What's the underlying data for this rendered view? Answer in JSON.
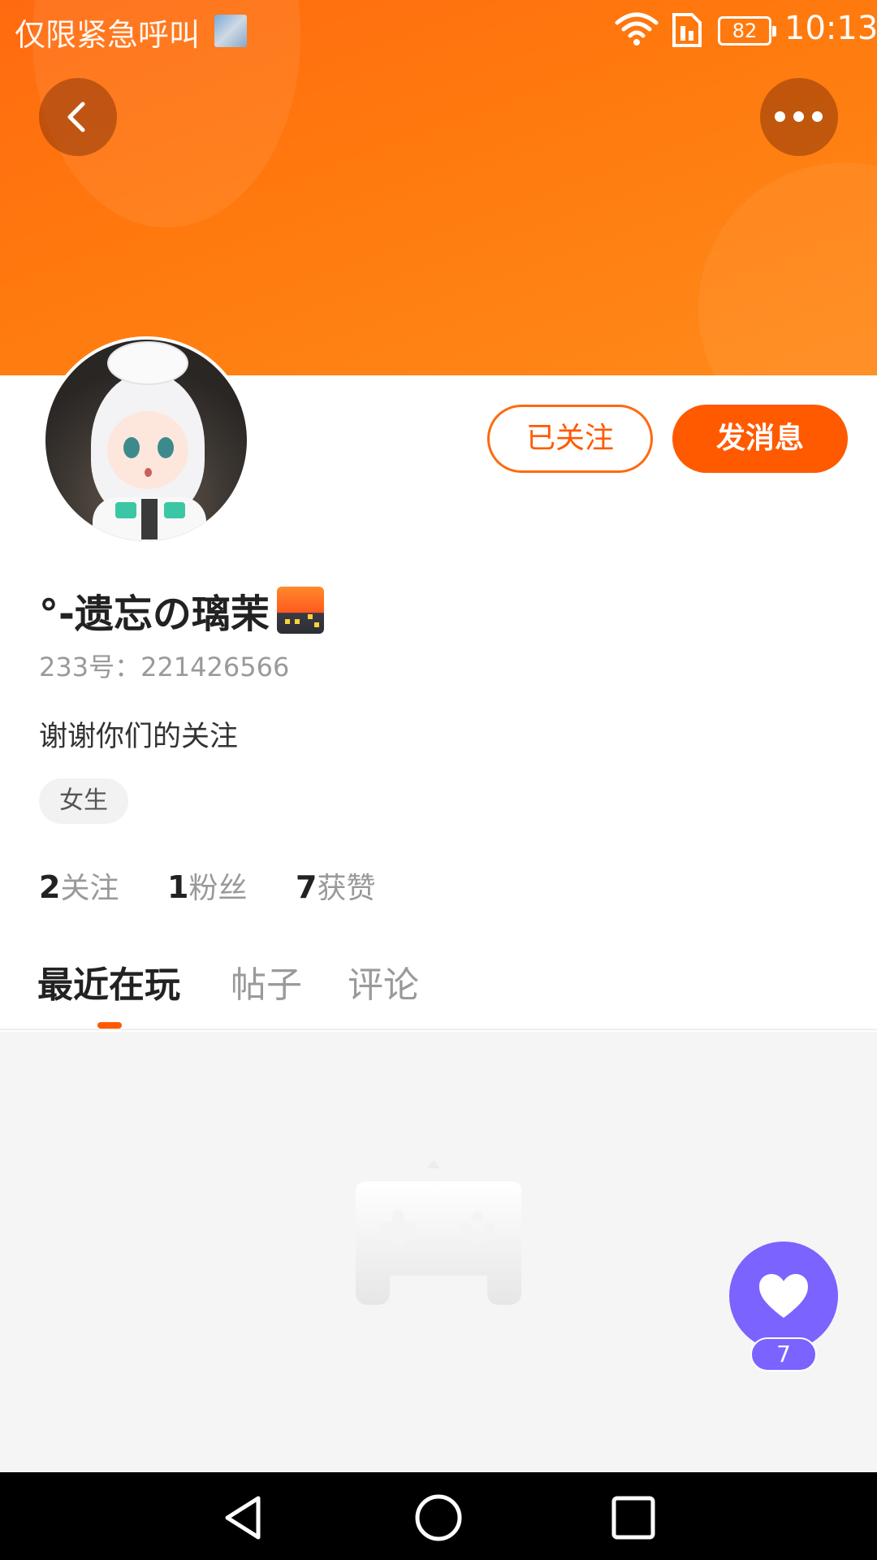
{
  "status_bar": {
    "carrier": "仅限紧急呼叫",
    "battery": "82",
    "time": "10:13"
  },
  "header": {
    "back_icon": "chevron-left-icon",
    "more_icon": "more-horizontal-icon"
  },
  "profile": {
    "nickname": "°-遗忘の璃茉",
    "uid": "233号：221426566",
    "bio": "谢谢你们的关注",
    "gender_tag": "女生",
    "followed_label": "已关注",
    "message_label": "发消息"
  },
  "stats": {
    "following": {
      "num": "2",
      "label": "关注"
    },
    "fans": {
      "num": "1",
      "label": "粉丝"
    },
    "likes": {
      "num": "7",
      "label": "获赞"
    }
  },
  "tabs": [
    {
      "label": "最近在玩",
      "active": true
    },
    {
      "label": "帖子",
      "active": false
    },
    {
      "label": "评论",
      "active": false
    }
  ],
  "like_fab": {
    "count": "7",
    "icon": "heart-icon"
  },
  "colors": {
    "accent": "#ff5a00",
    "banner": "#ff7a0e",
    "like": "#7a63ff"
  }
}
